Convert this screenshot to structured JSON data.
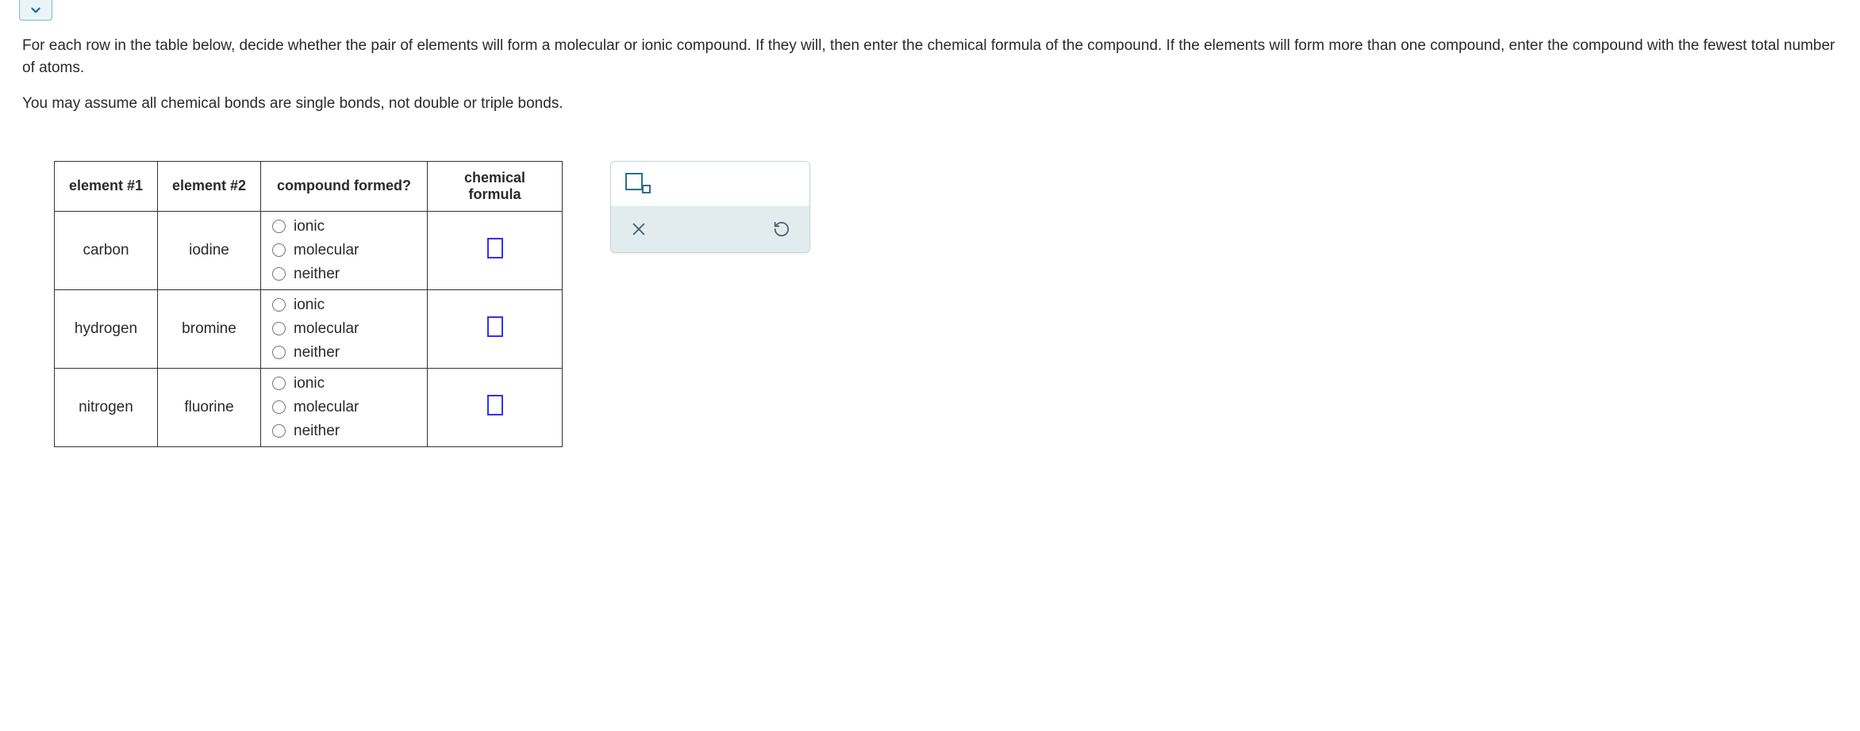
{
  "question": {
    "para1": "For each row in the table below, decide whether the pair of elements will form a molecular or ionic compound. If they will, then enter the chemical formula of the compound. If the elements will form more than one compound, enter the compound with the fewest total number of atoms.",
    "para2": "You may assume all chemical bonds are single bonds, not double or triple bonds."
  },
  "table": {
    "headers": {
      "c1": "element #1",
      "c2": "element #2",
      "c3": "compound formed?",
      "c4": "chemical formula"
    },
    "options": {
      "ionic": "ionic",
      "molecular": "molecular",
      "neither": "neither"
    },
    "rows": [
      {
        "e1": "carbon",
        "e2": "iodine"
      },
      {
        "e1": "hydrogen",
        "e2": "bromine"
      },
      {
        "e1": "nitrogen",
        "e2": "fluorine"
      }
    ]
  }
}
